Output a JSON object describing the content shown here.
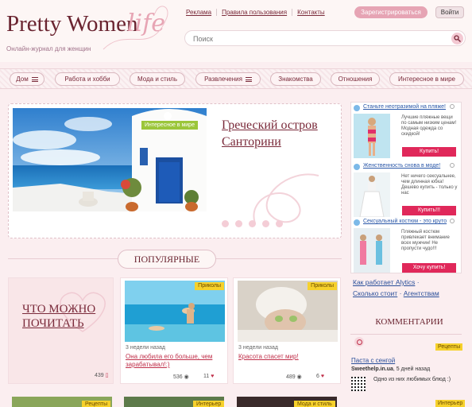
{
  "header": {
    "logo": "Pretty Women",
    "logo_script": "life",
    "tagline": "Онлайн-журнал для женщин",
    "links": [
      "Реклама",
      "Правила пользования",
      "Контакты"
    ],
    "register": "Зарегистрироваться",
    "login": "Войти",
    "search_placeholder": "Поиск"
  },
  "nav": {
    "items": [
      "Дом",
      "Работа и хобби",
      "Мода и стиль",
      "Развлечения",
      "Знакомства",
      "Отношения",
      "Интересное в мире"
    ]
  },
  "feature": {
    "tag": "Интересное в мире",
    "title": "Греческий остров Санторини",
    "slides": 5,
    "active_slide": 1
  },
  "popular": {
    "heading": "ПОПУЛЯРНЫЕ",
    "big_card": {
      "title": "ЧТО МОЖНО ПОЧИТАТЬ",
      "count": "439"
    },
    "cards": [
      {
        "tag": "Приколы",
        "date": "3 недели назад",
        "title": "Она любила его больше, чем зарабатывал!:)",
        "views": "536",
        "likes": "11"
      },
      {
        "tag": "Приколы",
        "date": "3 недели назад",
        "title": "Красота спасет мир!",
        "views": "489",
        "likes": "6"
      }
    ],
    "bottom_tags": [
      "Рецепты",
      "Интерьер",
      "Мода и стиль"
    ]
  },
  "ads": [
    {
      "title": "Станьте неотразимой на пляже!",
      "text": "Лучшие пляжные вещи по самым низким ценам! Модная одежда со скидкой!",
      "button": "Купить!"
    },
    {
      "title": "Женственность снова в моде!",
      "text": "Нет ничего сексуальнее, чем длинная юбка! Дешево купить - только у нас",
      "button": "Купить!!!"
    },
    {
      "title": "Сексуальный костюм - это круто",
      "text": "Пляжный костюм привлекает внимание всех мужчин! Не пропусти чудо!!!",
      "button": "Хочу купить!"
    }
  ],
  "ad_links": [
    "Как работает Alytics",
    "Сколько стоит",
    "Агентствам"
  ],
  "comments": {
    "heading": "КОММЕНТАРИИ",
    "tag": "Рецепты",
    "title": "Паста с сенгой",
    "user": "Sweethelp.in.ua",
    "time": "5 дней назад",
    "text": "Одно из них любимых блюд :)"
  },
  "right_bottom_tag": "Интерьер"
}
